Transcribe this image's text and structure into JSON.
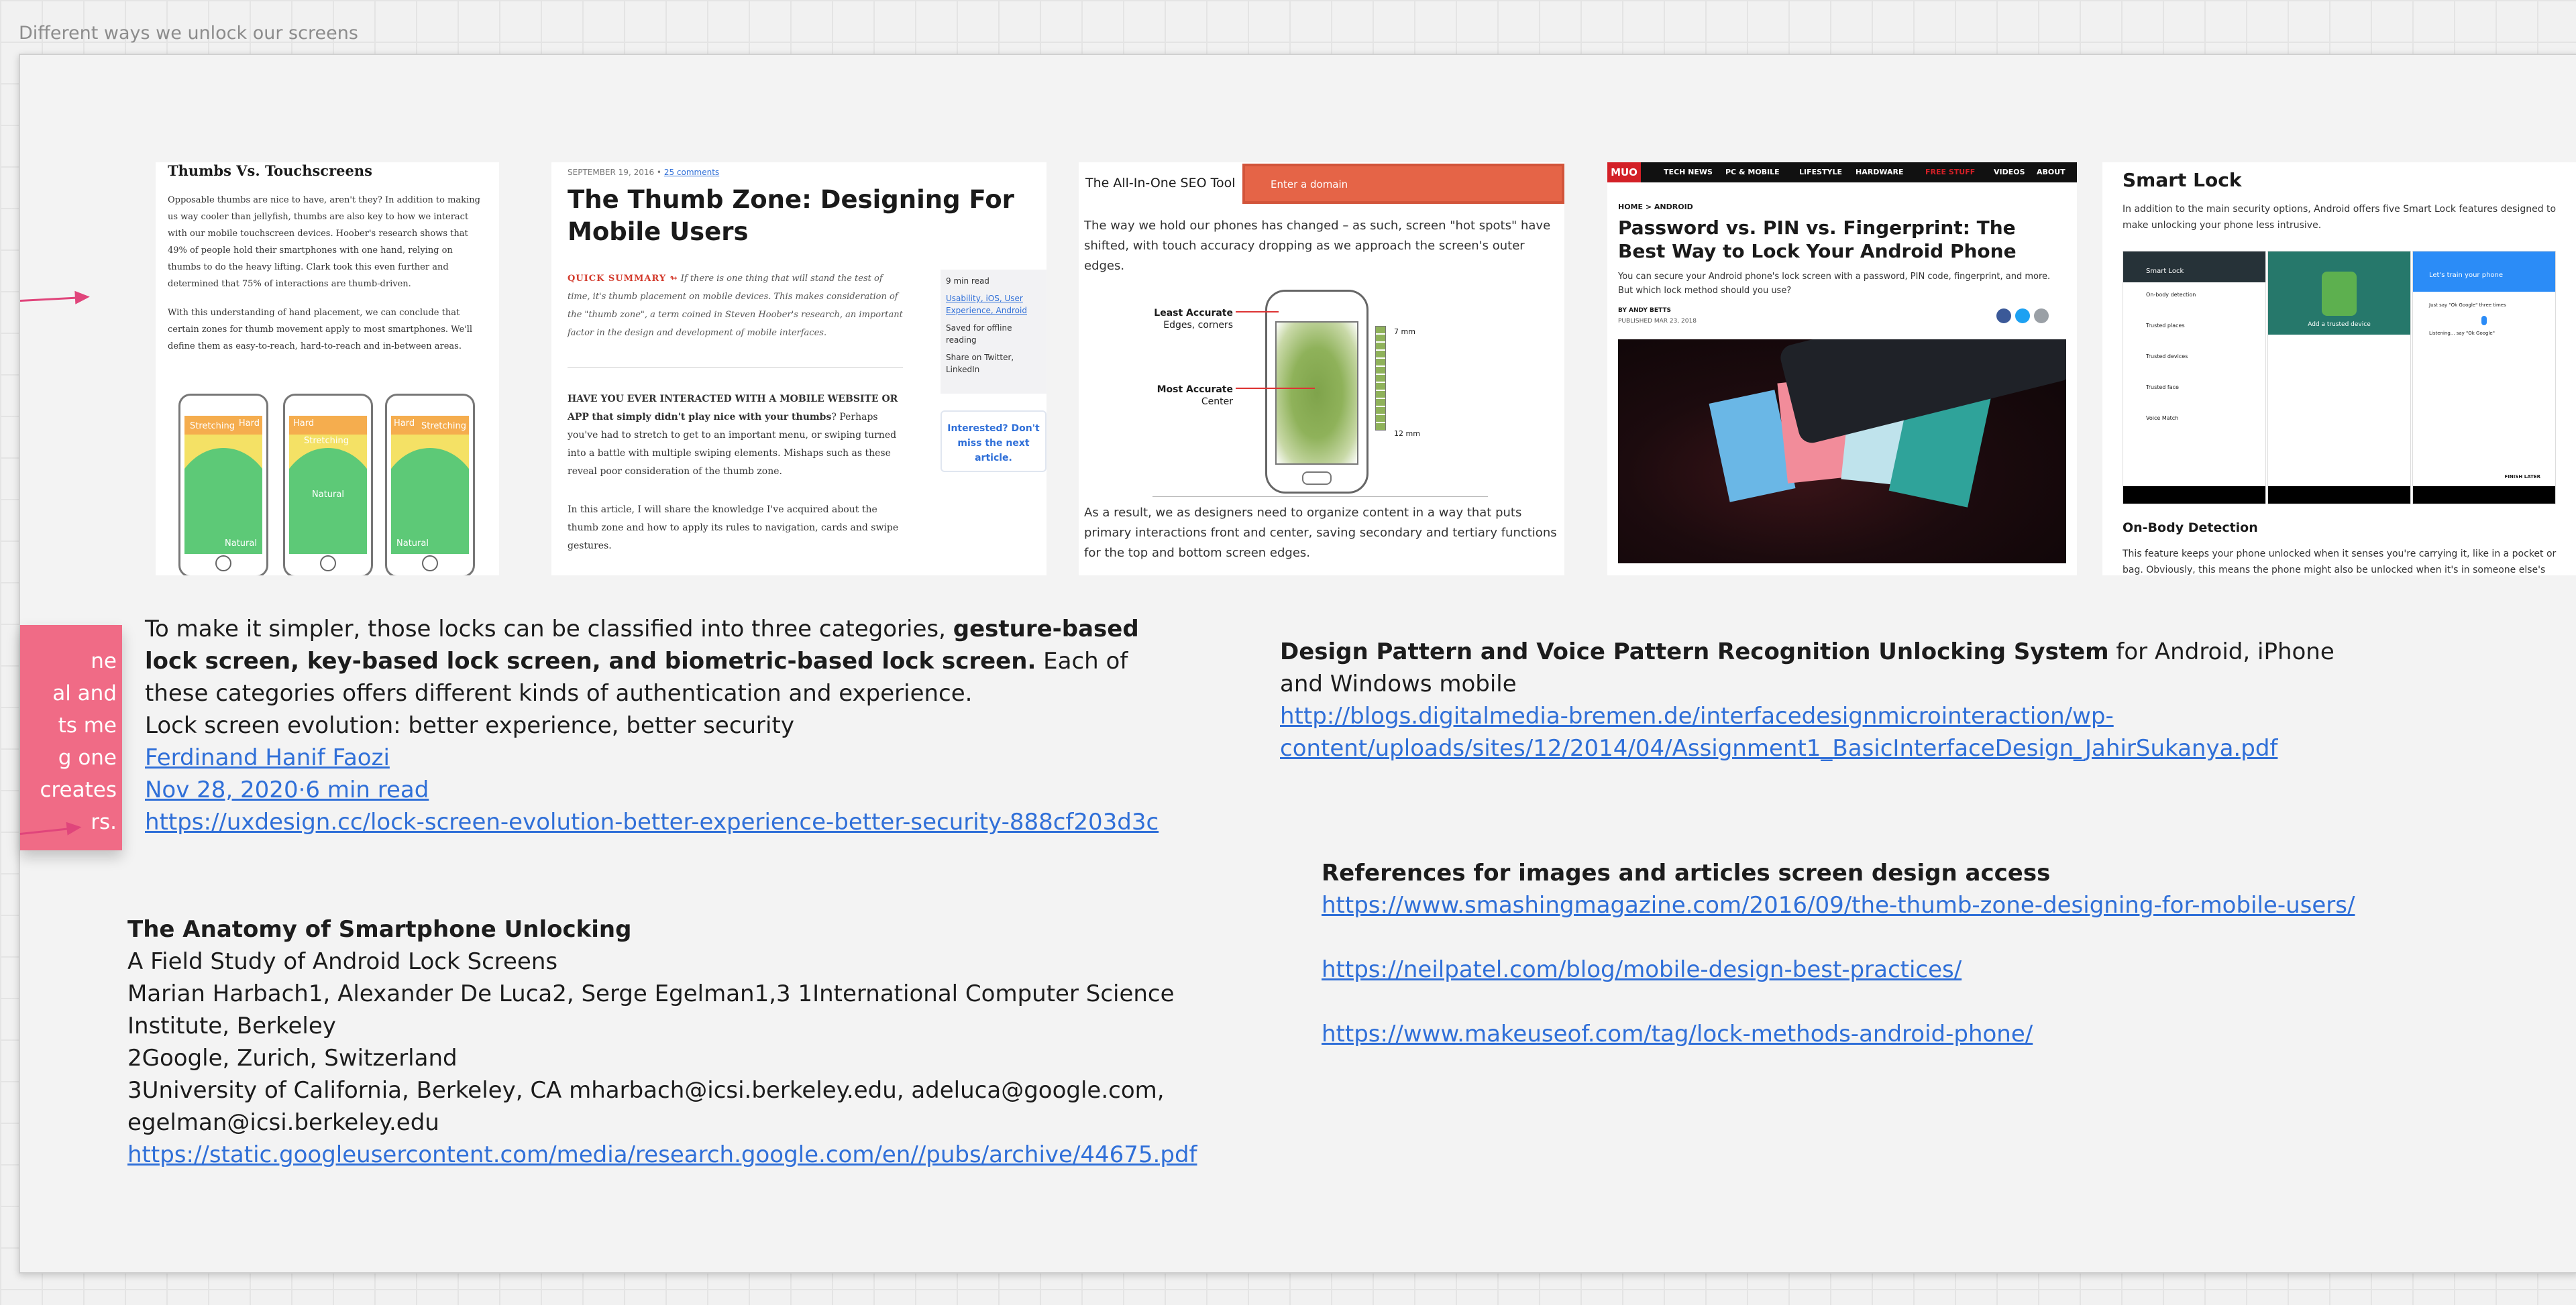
{
  "frame": {
    "title": "Different ways we unlock our screens"
  },
  "sticky": {
    "text": "ne\nal and\nts me\ng one\ncreates\nrs."
  },
  "card1": {
    "heading": "Thumbs Vs. Touchscreens",
    "p1": "Opposable thumbs are nice to have, aren't they? In addition to making us way cooler than jellyfish, thumbs are also key to how we interact with our mobile touchscreen devices. Hoober's research shows that 49% of people hold their smartphones with one hand, relying on thumbs to do the heavy lifting. Clark took this even further and determined that 75% of interactions are thumb-driven.",
    "p2": "With this understanding of hand placement, we can conclude that certain zones for thumb movement apply to most smartphones. We'll define them as easy-to-reach, hard-to-reach and in-between areas.",
    "zone_hard": "Hard",
    "zone_stretching": "Stretching",
    "zone_natural": "Natural"
  },
  "card2": {
    "date": "SEPTEMBER 19, 2016",
    "comments": "25 comments",
    "title": "The Thumb Zone: Designing For Mobile Users",
    "summary_label": "QUICK SUMMARY ↬",
    "summary": "If there is one thing that will stand the test of time, it's thumb placement on mobile devices. This makes consideration of the \"thumb zone\", a term coined in Steven Hoober's research, an important factor in the design and development of mobile interfaces.",
    "p_lead": "HAVE YOU EVER INTERACTED WITH A MOBILE WEBSITE OR APP",
    "p_bold": "that simply didn't play nice with your thumbs",
    "p_rest": "? Perhaps you've had to stretch to get to an important menu, or swiping turned into a battle with multiple swiping elements. Mishaps such as these reveal poor consideration of the thumb zone.",
    "p2": "In this article, I will share the knowledge I've acquired about the thumb zone and how to apply its rules to navigation, cards and swipe gestures.",
    "meta_read": "9 min read",
    "meta_tags": "Usability, iOS, User Experience, Android",
    "meta_offline": "Saved for offline reading",
    "meta_share": "Share on Twitter, LinkedIn",
    "cta": "Interested? Don't miss the next article."
  },
  "card3": {
    "tool": "The All-In-One SEO Tool",
    "domain_placeholder": "Enter a domain",
    "p1": "The way we hold our phones has changed – as such, screen \"hot spots\" have shifted, with touch accuracy dropping as we approach the screen's outer edges.",
    "least_label": "Least Accurate",
    "least_sub": "Edges, corners",
    "most_label": "Most Accurate",
    "most_sub": "Center",
    "mm7": "7 mm",
    "mm12": "12 mm",
    "p2": "As a result, we as designers need to organize content in a way that puts primary interactions front and center, saving secondary and tertiary functions for the top and bottom screen edges."
  },
  "card4": {
    "logo": "MUO",
    "nav": [
      "TECH NEWS",
      "PC & MOBILE",
      "LIFESTYLE",
      "HARDWARE",
      "FREE STUFF",
      "VIDEOS",
      "ABOUT"
    ],
    "crumb": "HOME  >  ANDROID",
    "title": "Password vs. PIN vs. Fingerprint: The Best Way to Lock Your Android Phone",
    "lead": "You can secure your Android phone's lock screen with a password, PIN code, fingerprint, and more. But which lock method should you use?",
    "byline": "BY ANDY BETTS",
    "published": "PUBLISHED MAR 23, 2018"
  },
  "card5": {
    "title": "Smart Lock",
    "p1": "In addition to the main security options, Android offers five Smart Lock features designed to make unlocking your phone less intrusive.",
    "s1_title": "Smart Lock",
    "s1_items": [
      "On-body detection",
      "Trusted places",
      "Trusted devices",
      "Trusted face",
      "Voice Match"
    ],
    "s2_label": "Add a trusted device",
    "s3_title": "Let's train your phone",
    "s3_hint": "Just say \"Ok Google\" three times",
    "s3_listen": "Listening... say \"Ok Google\"",
    "s3_btn": "FINISH LATER",
    "subhead": "On-Body Detection",
    "p2": "This feature keeps your phone unlocked when it senses you're carrying it, like in a pocket or bag. Obviously, this means the phone might also be unlocked when it's in someone else's"
  },
  "text1": {
    "line_a": "To make it simpler, those locks can be classified into three categories, ",
    "bold_a": "gesture-based lock screen, key-based lock screen, and biometric-based lock screen.",
    "line_b": " Each of these categories offers different kinds of authentication and experience.",
    "line_c": " Lock screen evolution: better experience, better security",
    "author": "Ferdinand Hanif Faozi",
    "date": "Nov 28, 2020·6 min read",
    "url": "https://uxdesign.cc/lock-screen-evolution-better-experience-better-security-888cf203d3c"
  },
  "text2": {
    "title": "The Anatomy of Smartphone Unlocking",
    "line1": "A Field Study of Android Lock Screens",
    "line2": " Marian Harbach1, Alexander De Luca2, Serge Egelman1,3 1International Computer Science Institute, Berkeley",
    "line3": " 2Google, Zurich, Switzerland",
    "line4": " 3University of California, Berkeley, CA mharbach@icsi.berkeley.edu, adeluca@google.com, egelman@icsi.berkeley.edu",
    "url": "https://static.googleusercontent.com/media/research.google.com/en//pubs/archive/44675.pdf"
  },
  "text3": {
    "bold": "Design Pattern and Voice Pattern Recognition Unlocking System",
    "rest": " for Android, iPhone and Windows mobile",
    "url_a": "http://blogs.digitalmedia-bremen.de/interfacedesignmicrointeraction/wp-",
    "url_b": "content/uploads/sites/12/2014/04/Assignment1_BasicInterfaceDesign_JahirSukanya.pdf"
  },
  "text4": {
    "title": "References for images and articles screen design access",
    "url1": "https://www.smashingmagazine.com/2016/09/the-thumb-zone-designing-for-mobile-users/",
    "url2": "https://neilpatel.com/blog/mobile-design-best-practices/",
    "url3": "https://www.makeuseof.com/tag/lock-methods-android-phone/"
  }
}
